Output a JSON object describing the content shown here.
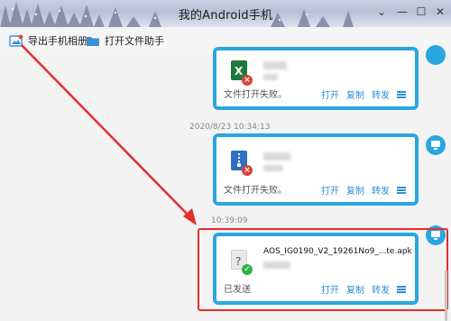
{
  "window": {
    "title": "我的Android手机",
    "controls": {
      "dropdown": "⌄",
      "minimize": "—",
      "maximize": "☐",
      "close": "✕"
    }
  },
  "toolbar": {
    "export_label": "导出手机相册",
    "open_label": "打开文件助手"
  },
  "messages": [
    {
      "time": "",
      "file_type": "excel-icon",
      "status_icon": "error",
      "status": "文件打开失败。",
      "actions": [
        "打开",
        "复制",
        "转发"
      ]
    },
    {
      "time": "2020/8/23 10:34:13",
      "file_type": "archive-icon",
      "status_icon": "error",
      "status": "文件打开失败。",
      "actions": [
        "打开",
        "复制",
        "转发"
      ]
    },
    {
      "time": "10:39:09",
      "file_type": "unknown-file-icon",
      "status_icon": "success",
      "file_name": "AOS_IG0190_V2_19261No9_...te.apk",
      "status": "已发送",
      "actions": [
        "打开",
        "复制",
        "转发"
      ]
    }
  ],
  "colors": {
    "accent": "#2aa6e0",
    "link": "#2a8fd6",
    "highlight": "#e0302a",
    "error": "#d9433a",
    "success": "#2fb24a"
  }
}
